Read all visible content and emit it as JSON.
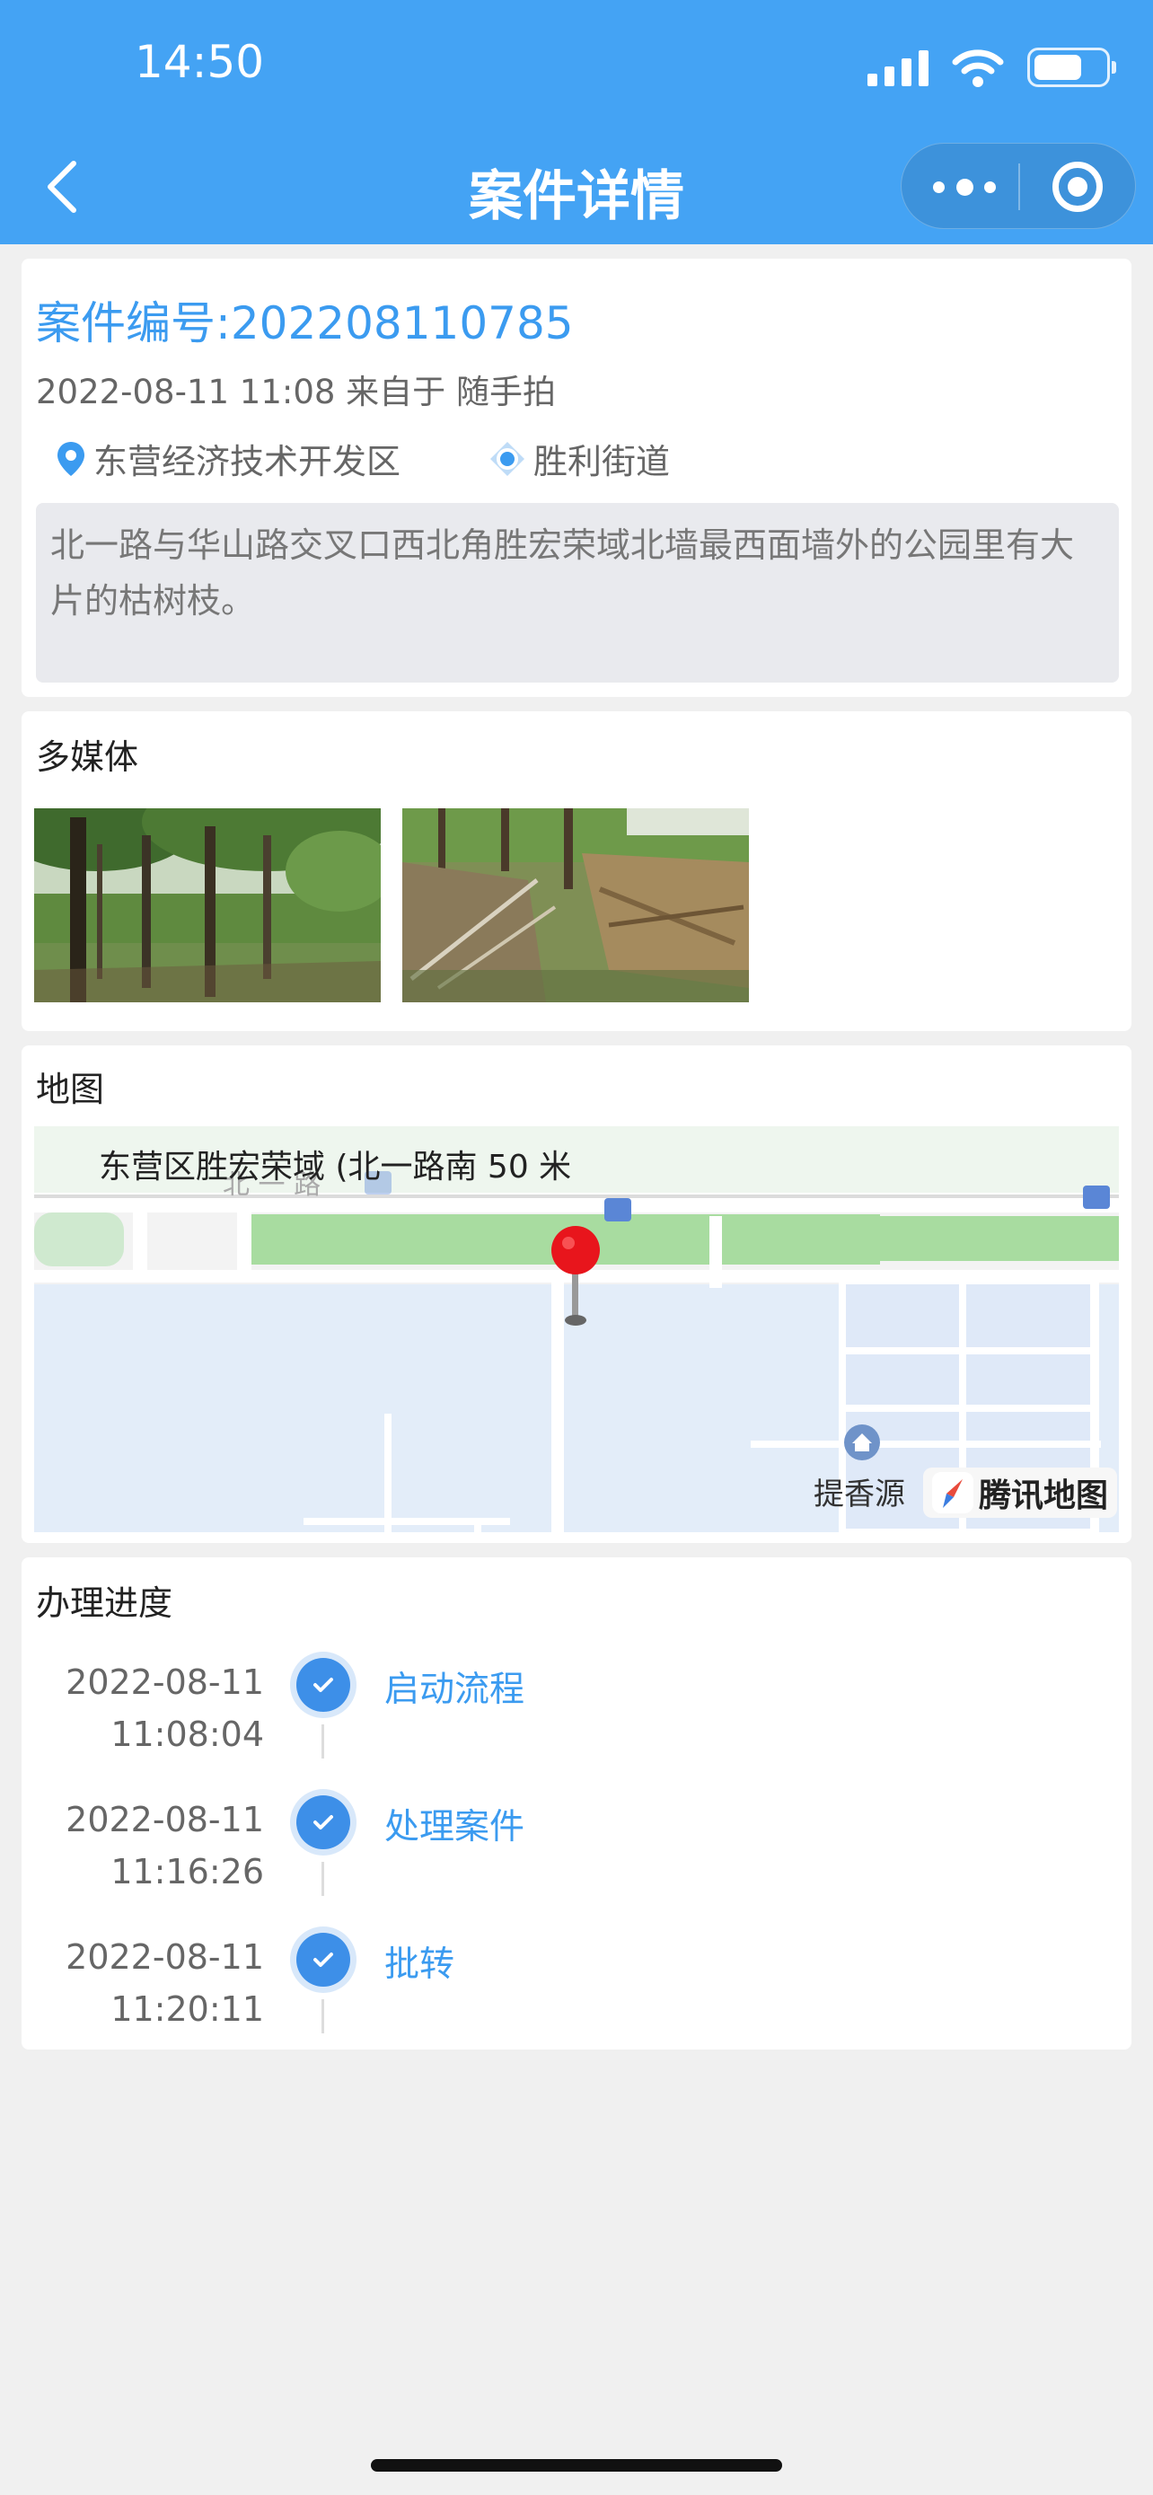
{
  "status_bar": {
    "time": "14:50",
    "battery_level": 0.6
  },
  "nav": {
    "title": "案件详情"
  },
  "case": {
    "number": "案件编号:202208110785",
    "meta": "2022-08-11 11:08 来自于 随手拍",
    "district": "东营经济技术开发区",
    "street": "胜利街道",
    "description": "北一路与华山路交叉口西北角胜宏荣域北墙最西面墙外的公园里有大片的枯树枝。"
  },
  "media": {
    "title": "多媒体"
  },
  "map": {
    "title": "地图",
    "address": "东营区胜宏荣域 (北一路南 50 米",
    "poi": "提香源",
    "road_label": "北 一 路",
    "provider": "腾讯地图"
  },
  "progress": {
    "title": "办理进度",
    "steps": [
      {
        "date": "2022-08-11",
        "time": "11:08:04",
        "label": "启动流程"
      },
      {
        "date": "2022-08-11",
        "time": "11:16:26",
        "label": "处理案件"
      },
      {
        "date": "2022-08-11",
        "time": "11:20:11",
        "label": "批转"
      }
    ]
  },
  "colors": {
    "header": "#44a3f4",
    "accent": "#3b9bf0",
    "marker": "#e8151c"
  }
}
